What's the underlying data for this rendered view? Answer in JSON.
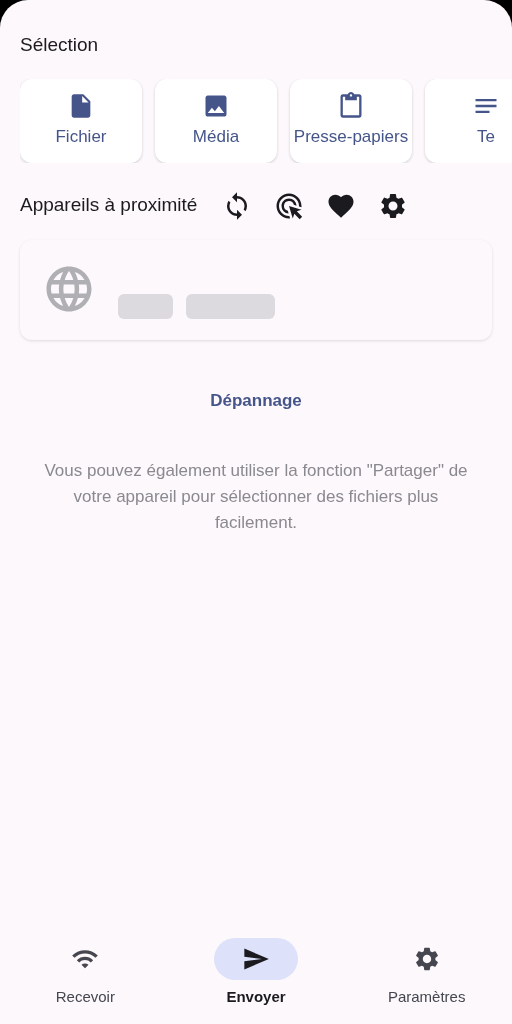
{
  "selection": {
    "title": "Sélection",
    "options": [
      {
        "kind": "file",
        "label": "Fichier"
      },
      {
        "kind": "media",
        "label": "Média"
      },
      {
        "kind": "clipboard",
        "label": "Presse-papiers"
      },
      {
        "kind": "text",
        "label": "Te"
      }
    ]
  },
  "nearby": {
    "title": "Appareils à proximité",
    "actions": [
      {
        "kind": "refresh"
      },
      {
        "kind": "scan"
      },
      {
        "kind": "favorites"
      },
      {
        "kind": "settings"
      }
    ]
  },
  "troubleshoot": "Dépannage",
  "hint": "Vous pouvez également utiliser la fonction \"Partager\" de votre appareil pour sélectionner des fichiers plus facilement.",
  "nav": [
    {
      "kind": "receive",
      "label": "Recevoir",
      "selected": false
    },
    {
      "kind": "send",
      "label": "Envoyer",
      "selected": true
    },
    {
      "kind": "settings",
      "label": "Paramètres",
      "selected": false
    }
  ]
}
